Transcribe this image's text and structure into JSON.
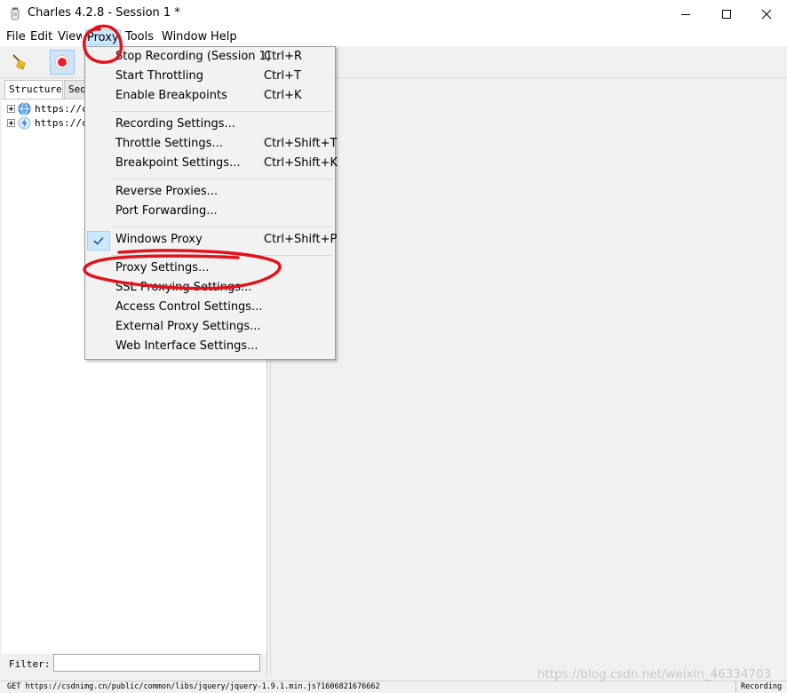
{
  "window": {
    "title": "Charles 4.2.8 - Session 1 *",
    "icon": "charles-jar-icon"
  },
  "menubar": {
    "items": [
      "File",
      "Edit",
      "View",
      "Proxy",
      "Tools",
      "Window",
      "Help"
    ],
    "active": "Proxy"
  },
  "toolbar": {
    "buttons": [
      {
        "name": "clear-session-broom-icon"
      },
      {
        "name": "record-icon",
        "pressed": true
      }
    ]
  },
  "left_panel": {
    "tabs": [
      "Structure",
      "Seq"
    ],
    "selected_tab": "Structure",
    "tree": [
      {
        "label": "https://c",
        "icon": "globe-icon"
      },
      {
        "label": "https://c",
        "icon": "lightning-icon"
      }
    ],
    "filter": {
      "label": "Filter:",
      "value": ""
    }
  },
  "proxy_menu": {
    "items": [
      {
        "label": "Stop Recording (Session 1)",
        "shortcut": "Ctrl+R"
      },
      {
        "label": "Start Throttling",
        "shortcut": "Ctrl+T"
      },
      {
        "label": "Enable Breakpoints",
        "shortcut": "Ctrl+K"
      },
      {
        "label": "Recording Settings...",
        "shortcut": ""
      },
      {
        "label": "Throttle Settings...",
        "shortcut": "Ctrl+Shift+T"
      },
      {
        "label": "Breakpoint Settings...",
        "shortcut": "Ctrl+Shift+K"
      },
      {
        "label": "Reverse Proxies...",
        "shortcut": ""
      },
      {
        "label": "Port Forwarding...",
        "shortcut": ""
      },
      {
        "label": "Windows Proxy",
        "shortcut": "Ctrl+Shift+P",
        "checked": true
      },
      {
        "label": "Proxy Settings...",
        "shortcut": ""
      },
      {
        "label": "SSL Proxying Settings...",
        "shortcut": ""
      },
      {
        "label": "Access Control Settings...",
        "shortcut": ""
      },
      {
        "label": "External Proxy Settings...",
        "shortcut": ""
      },
      {
        "label": "Web Interface Settings...",
        "shortcut": ""
      }
    ]
  },
  "statusbar": {
    "text": "GET https://csdnimg.cn/public/common/libs/jquery/jquery-1.9.1.min.js?1606821676662",
    "badge": "Recording"
  },
  "watermark": "https://blog.csdn.net/weixin_46334703",
  "colors": {
    "menu_highlight": "#cce8ff",
    "annotation_red": "#e0141e",
    "record_red": "#e8202a"
  }
}
